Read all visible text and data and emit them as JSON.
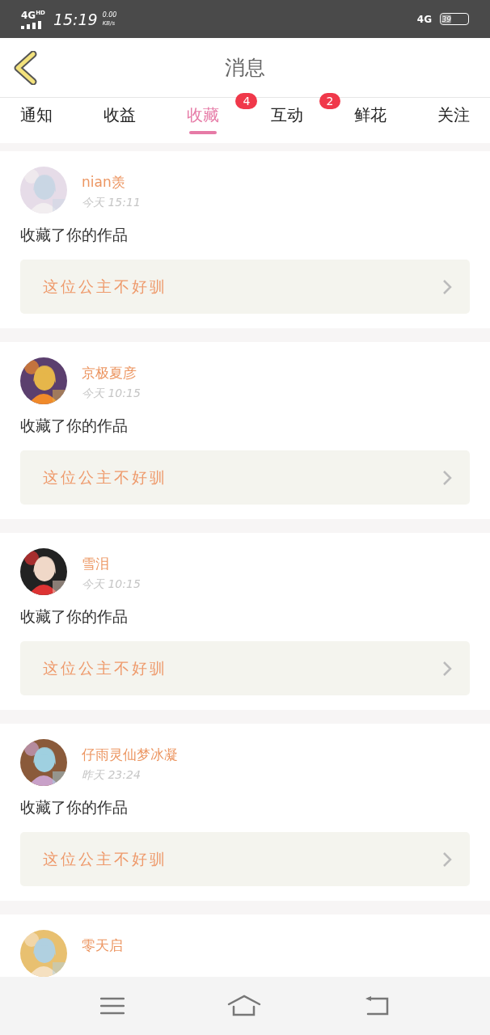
{
  "status_bar": {
    "network": "4G",
    "network_badge": "HD",
    "time": "15:19",
    "speed": "0.00",
    "speed_unit": "KB/s",
    "network_right": "4G",
    "battery": "39"
  },
  "header": {
    "title": "消息"
  },
  "tabs": [
    {
      "label": "通知",
      "selected": false
    },
    {
      "label": "收益",
      "selected": false
    },
    {
      "label": "收藏",
      "selected": true,
      "badge": "4"
    },
    {
      "label": "互动",
      "selected": false,
      "badge": "2"
    },
    {
      "label": "鲜花",
      "selected": false
    },
    {
      "label": "关注",
      "selected": false
    }
  ],
  "messages": [
    {
      "name": "nian羡",
      "time": "今天 15:11",
      "text": "收藏了你的作品",
      "work": "这位公主不好驯"
    },
    {
      "name": "京极夏彦",
      "time": "今天 10:15",
      "text": "收藏了你的作品",
      "work": "这位公主不好驯"
    },
    {
      "name": "雪泪",
      "time": "今天 10:15",
      "text": "收藏了你的作品",
      "work": "这位公主不好驯"
    },
    {
      "name": "仔雨灵仙梦冰凝",
      "time": "昨天 23:24",
      "text": "收藏了你的作品",
      "work": "这位公主不好驯"
    },
    {
      "name": "零天启"
    }
  ]
}
